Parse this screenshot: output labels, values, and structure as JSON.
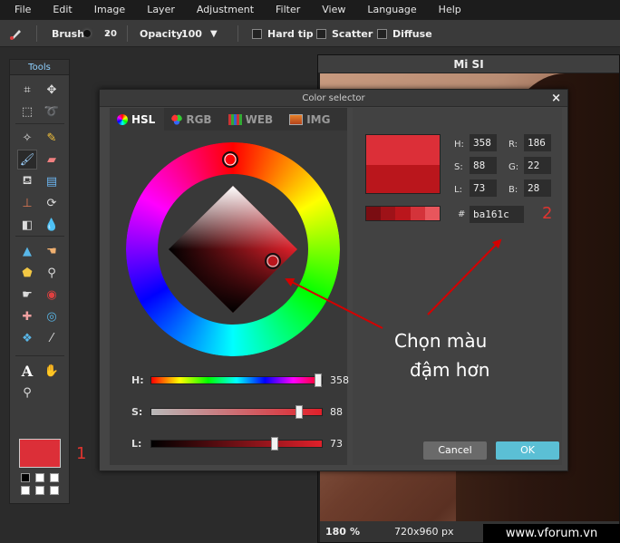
{
  "menubar": {
    "items": [
      "File",
      "Edit",
      "Image",
      "Layer",
      "Adjustment",
      "Filter",
      "View",
      "Language",
      "Help"
    ]
  },
  "options": {
    "brush_label": "Brush:",
    "brush_size": "20",
    "opacity_label": "Opacity:",
    "opacity_value": "100",
    "hard_tip": "Hard tip",
    "scatter": "Scatter",
    "diffuse": "Diffuse"
  },
  "tools": {
    "title": "Tools",
    "items": [
      "crop-icon",
      "move-icon",
      "marquee-icon",
      "lasso-icon",
      "magic-wand-icon",
      "pencil-icon",
      "brush-icon",
      "eraser-icon",
      "bucket-icon",
      "gradient-icon",
      "clone-stamp-icon",
      "color-replace-icon",
      "draw-shape-icon",
      "drop-icon",
      "sharpen-icon",
      "smudge-icon",
      "sponge-icon",
      "dodge-icon",
      "burn-icon",
      "red-eye-icon",
      "spot-heal-icon",
      "bloat-icon",
      "pinch-icon",
      "color-picker-icon",
      "type-icon",
      "hand-icon",
      "zoom-icon"
    ],
    "fg_color": "#dc2f38"
  },
  "image_window": {
    "title": "Mi SI",
    "zoom": "180",
    "zoom_unit": "%",
    "dimensions": "720x960 px"
  },
  "watermark": "www.vforum.vn",
  "dialog": {
    "title": "Color selector",
    "close": "×",
    "tabs": [
      "HSL",
      "RGB",
      "WEB",
      "IMG"
    ],
    "active_tab": "HSL",
    "fields": {
      "H_label": "H:",
      "H": "358",
      "S_label": "S:",
      "S": "88",
      "L_label": "L:",
      "L": "73",
      "R_label": "R:",
      "R": "186",
      "G_label": "G:",
      "G": "22",
      "B_label": "B:",
      "B": "28"
    },
    "hex_label": "#",
    "hex": "ba161c",
    "sliders": {
      "H_label": "H:",
      "H_value": "358",
      "H_fraction": 0.994,
      "S_label": "S:",
      "S_value": "88",
      "S_fraction": 0.88,
      "L_label": "L:",
      "L_value": "73",
      "L_fraction": 0.73
    },
    "swatch_new": "#dc2f38",
    "swatch_old": "#ba161c",
    "strip_colors": [
      "#7a0d12",
      "#9e1218",
      "#ba161c",
      "#d4333a",
      "#e8565c"
    ],
    "cancel": "Cancel",
    "ok": "OK"
  },
  "annotations": {
    "marker_1": "1",
    "marker_2": "2",
    "text_line1": "Chọn màu",
    "text_line2": "đậm hơn",
    "color": "#d40000"
  }
}
